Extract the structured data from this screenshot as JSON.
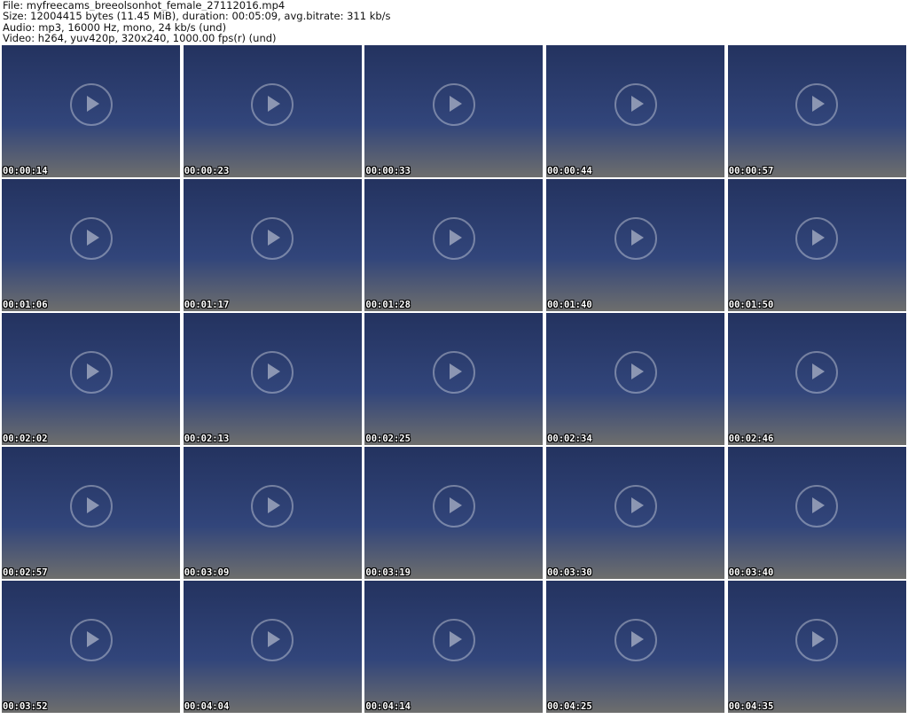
{
  "header": {
    "file_line": "File: myfreecams_breeolsonhot_female_27112016.mp4",
    "size_line": "Size: 12004415 bytes (11.45 MiB), duration: 00:05:09, avg.bitrate: 311 kb/s",
    "audio_line": "Audio: mp3, 16000 Hz, mono, 24 kb/s (und)",
    "video_line": "Video: h264, yuv420p, 320x240, 1000.00 fps(r) (und)"
  },
  "thumbnails": [
    {
      "timestamp": "00:00:14"
    },
    {
      "timestamp": "00:00:23"
    },
    {
      "timestamp": "00:00:33"
    },
    {
      "timestamp": "00:00:44"
    },
    {
      "timestamp": "00:00:57"
    },
    {
      "timestamp": "00:01:06"
    },
    {
      "timestamp": "00:01:17"
    },
    {
      "timestamp": "00:01:28"
    },
    {
      "timestamp": "00:01:40"
    },
    {
      "timestamp": "00:01:50"
    },
    {
      "timestamp": "00:02:02"
    },
    {
      "timestamp": "00:02:13"
    },
    {
      "timestamp": "00:02:25"
    },
    {
      "timestamp": "00:02:34"
    },
    {
      "timestamp": "00:02:46"
    },
    {
      "timestamp": "00:02:57"
    },
    {
      "timestamp": "00:03:09"
    },
    {
      "timestamp": "00:03:19"
    },
    {
      "timestamp": "00:03:30"
    },
    {
      "timestamp": "00:03:40"
    },
    {
      "timestamp": "00:03:52"
    },
    {
      "timestamp": "00:04:04"
    },
    {
      "timestamp": "00:04:14"
    },
    {
      "timestamp": "00:04:25"
    },
    {
      "timestamp": "00:04:35"
    }
  ]
}
